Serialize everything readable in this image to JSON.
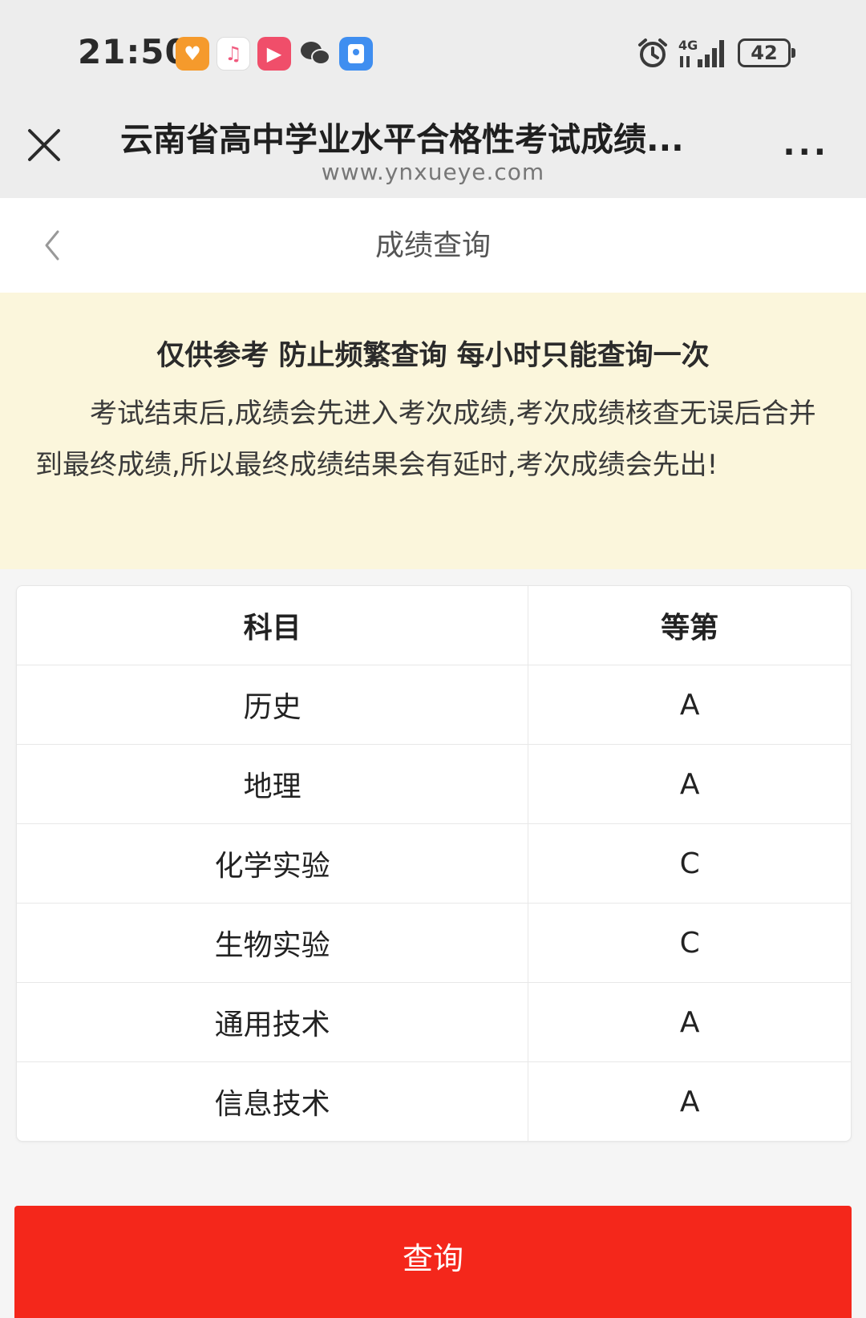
{
  "status_bar": {
    "time": "21:50",
    "network": "4G",
    "battery": "42",
    "app_icons": [
      "heart-app-icon",
      "music-icon",
      "video-icon",
      "wechat-icon",
      "assistant-app-icon"
    ]
  },
  "browser": {
    "title": "云南省高中学业水平合格性考试成绩...",
    "url": "www.ynxueye.com",
    "more_label": "..."
  },
  "page": {
    "header_title": "成绩查询"
  },
  "notice": {
    "headline": "仅供参考 防止频繁查询 每小时只能查询一次",
    "body": "考试结束后,成绩会先进入考次成绩,考次成绩核查无误后合并到最终成绩,所以最终成绩结果会有延时,考次成绩会先出!"
  },
  "table": {
    "headers": [
      "科目",
      "等第"
    ],
    "rows": [
      [
        "历史",
        "A"
      ],
      [
        "地理",
        "A"
      ],
      [
        "化学实验",
        "C"
      ],
      [
        "生物实验",
        "C"
      ],
      [
        "通用技术",
        "A"
      ],
      [
        "信息技术",
        "A"
      ]
    ]
  },
  "query_button_label": "查询",
  "colors": {
    "notice_bg": "#fbf6dc",
    "button_red": "#f4271b",
    "chrome_gray": "#ededed"
  }
}
